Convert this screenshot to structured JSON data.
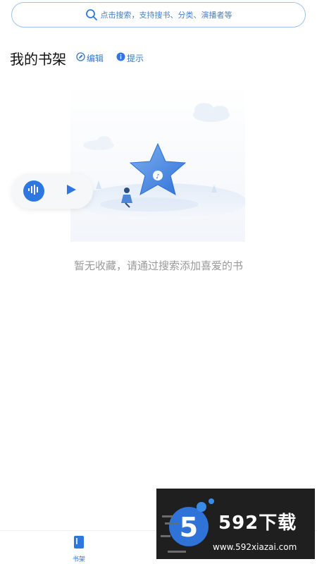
{
  "search": {
    "placeholder": "点击搜索，支持搜书、分类、演播者等"
  },
  "header": {
    "title": "我的书架",
    "edit_label": "编辑",
    "tip_label": "提示"
  },
  "empty_state": {
    "message": "暂无收藏，请通过搜索添加喜爱的书"
  },
  "bottom_nav": {
    "items": [
      {
        "label": "书架",
        "icon": "bookshelf-icon",
        "active": true
      }
    ]
  },
  "watermark": {
    "title": "592下载",
    "url": "www.592xiazai.com",
    "logo_digit": "5"
  },
  "colors": {
    "accent": "#2e77e0",
    "search_border": "#9fc2ea",
    "muted_text": "#9a9a9a"
  }
}
